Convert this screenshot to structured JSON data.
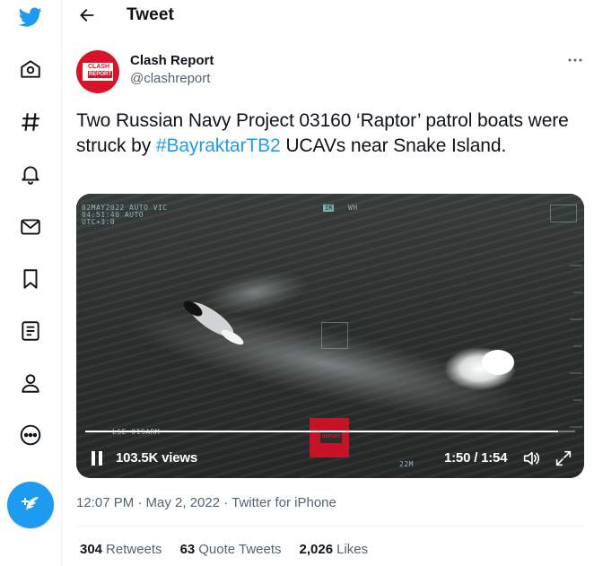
{
  "header": {
    "title": "Tweet"
  },
  "nav": {
    "items": [
      "twitter-logo",
      "explore",
      "hashtag",
      "notifications",
      "messages",
      "bookmarks",
      "lists",
      "profile",
      "more"
    ]
  },
  "author": {
    "display_name": "Clash Report",
    "handle": "@clashreport",
    "avatar_text_top": "CLASH",
    "avatar_text_bottom": "REPORT"
  },
  "tweet": {
    "text_before": "Two Russian Navy Project 03160 ‘Raptor’ patrol boats were struck by ",
    "hashtag": "#BayraktarTB2",
    "text_after": " UCAVs near Snake Island."
  },
  "video": {
    "views": "103.5K views",
    "time": "1:50 / 1:54",
    "progress": 0.965,
    "osd_line1": "02MAY2022  AUTO   VIC",
    "osd_line2": "04:51:40          AUTO",
    "osd_line3": "UTC+3:0",
    "osd_ir": "IR",
    "osd_wh": "WH",
    "osd_bottom": "LSE   01SARM",
    "osd_zoom": "22M",
    "watermark": "REPORT"
  },
  "meta": {
    "timestamp": "12:07 PM · May 2, 2022 · Twitter for iPhone"
  },
  "stats": {
    "retweets_count": "304",
    "retweets_label": "Retweets",
    "quotes_count": "63",
    "quotes_label": "Quote Tweets",
    "likes_count": "2,026",
    "likes_label": "Likes"
  },
  "colors": {
    "accent": "#1d9bf0",
    "brand_red": "#d7142a"
  }
}
